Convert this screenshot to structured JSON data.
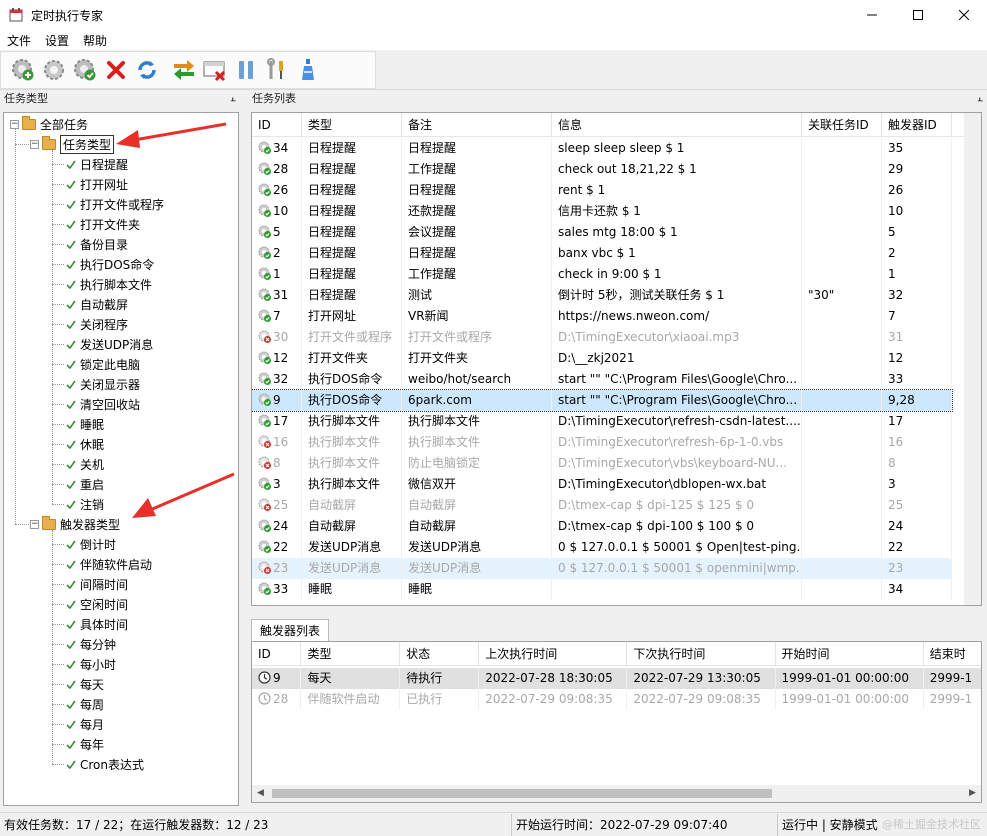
{
  "window": {
    "title": "定时执行专家"
  },
  "menu": [
    "文件",
    "设置",
    "帮助"
  ],
  "toolbar": {
    "buttons": [
      {
        "name": "add-task-button",
        "icon": "gear-add-icon"
      },
      {
        "name": "edit-task-button",
        "icon": "gear-icon"
      },
      {
        "name": "enable-task-button",
        "icon": "gear-check-icon"
      },
      {
        "name": "delete-task-button",
        "icon": "red-x-icon"
      },
      {
        "name": "refresh-button",
        "icon": "refresh-icon"
      },
      {
        "name": "swap-button",
        "icon": "swap-arrows-icon"
      },
      {
        "name": "remove-window-button",
        "icon": "window-x-icon"
      },
      {
        "name": "pause-button",
        "icon": "pause-icon"
      },
      {
        "name": "tools-button",
        "icon": "tools-icon"
      },
      {
        "name": "bottle-button",
        "icon": "bottle-icon"
      }
    ]
  },
  "left_pane": {
    "title": "任务类型",
    "root": "全部任务",
    "task_types_label": "任务类型",
    "task_types": [
      "日程提醒",
      "打开网址",
      "打开文件或程序",
      "打开文件夹",
      "备份目录",
      "执行DOS命令",
      "执行脚本文件",
      "自动截屏",
      "关闭程序",
      "发送UDP消息",
      "锁定此电脑",
      "关闭显示器",
      "清空回收站",
      "睡眠",
      "休眠",
      "关机",
      "重启",
      "注销"
    ],
    "trigger_types_label": "触发器类型",
    "trigger_types": [
      "倒计时",
      "伴随软件启动",
      "间隔时间",
      "空闲时间",
      "具体时间",
      "每分钟",
      "每小时",
      "每天",
      "每周",
      "每月",
      "每年",
      "Cron表达式"
    ]
  },
  "task_list": {
    "title": "任务列表",
    "columns": [
      "ID",
      "类型",
      "备注",
      "信息",
      "关联任务ID",
      "触发器ID"
    ],
    "rows": [
      {
        "id": "34",
        "type": "日程提醒",
        "note": "日程提醒",
        "info": "sleep sleep sleep $ 1",
        "rel": "",
        "trig": "35",
        "state": "on"
      },
      {
        "id": "28",
        "type": "日程提醒",
        "note": "工作提醒",
        "info": "check out 18,21,22 $ 1",
        "rel": "",
        "trig": "29",
        "state": "on"
      },
      {
        "id": "26",
        "type": "日程提醒",
        "note": "日程提醒",
        "info": "rent $ 1",
        "rel": "",
        "trig": "26",
        "state": "on"
      },
      {
        "id": "10",
        "type": "日程提醒",
        "note": "还款提醒",
        "info": "信用卡还款 $ 1",
        "rel": "",
        "trig": "10",
        "state": "on"
      },
      {
        "id": "5",
        "type": "日程提醒",
        "note": "会议提醒",
        "info": "sales mtg 18:00 $ 1",
        "rel": "",
        "trig": "5",
        "state": "on"
      },
      {
        "id": "2",
        "type": "日程提醒",
        "note": "日程提醒",
        "info": "banx vbc $ 1",
        "rel": "",
        "trig": "2",
        "state": "on"
      },
      {
        "id": "1",
        "type": "日程提醒",
        "note": "工作提醒",
        "info": "check in 9:00 $ 1",
        "rel": "",
        "trig": "1",
        "state": "on"
      },
      {
        "id": "31",
        "type": "日程提醒",
        "note": "测试",
        "info": "倒计时 5秒，测试关联任务 $ 1",
        "rel": "\"30\"",
        "trig": "32",
        "state": "on"
      },
      {
        "id": "7",
        "type": "打开网址",
        "note": "VR新闻",
        "info": "https://news.nweon.com/",
        "rel": "",
        "trig": "7",
        "state": "on"
      },
      {
        "id": "30",
        "type": "打开文件或程序",
        "note": "打开文件或程序",
        "info": "D:\\TimingExecutor\\xiaoai.mp3",
        "rel": "",
        "trig": "31",
        "state": "off"
      },
      {
        "id": "12",
        "type": "打开文件夹",
        "note": "打开文件夹",
        "info": "D:\\__zkj2021",
        "rel": "",
        "trig": "12",
        "state": "on"
      },
      {
        "id": "32",
        "type": "执行DOS命令",
        "note": "weibo/hot/search",
        "info": "start \"\" \"C:\\Program Files\\Google\\Chro...",
        "rel": "",
        "trig": "33",
        "state": "on"
      },
      {
        "id": "9",
        "type": "执行DOS命令",
        "note": "6park.com",
        "info": "start \"\" \"C:\\Program Files\\Google\\Chro...",
        "rel": "",
        "trig": "9,28",
        "state": "selected"
      },
      {
        "id": "17",
        "type": "执行脚本文件",
        "note": "执行脚本文件",
        "info": "D:\\TimingExecutor\\refresh-csdn-latest....",
        "rel": "",
        "trig": "17",
        "state": "on"
      },
      {
        "id": "16",
        "type": "执行脚本文件",
        "note": "执行脚本文件",
        "info": "D:\\TimingExecutor\\refresh-6p-1-0.vbs",
        "rel": "",
        "trig": "16",
        "state": "off"
      },
      {
        "id": "8",
        "type": "执行脚本文件",
        "note": "防止电脑锁定",
        "info": "D:\\TimingExecutor\\vbs\\keyboard-NU...",
        "rel": "",
        "trig": "8",
        "state": "off"
      },
      {
        "id": "3",
        "type": "执行脚本文件",
        "note": "微信双开",
        "info": "D:\\TimingExecutor\\dblopen-wx.bat",
        "rel": "",
        "trig": "3",
        "state": "on"
      },
      {
        "id": "25",
        "type": "自动截屏",
        "note": "自动截屏",
        "info": "D:\\tmex-cap $ dpi-125 $ 125 $ 0",
        "rel": "",
        "trig": "25",
        "state": "off"
      },
      {
        "id": "24",
        "type": "自动截屏",
        "note": "自动截屏",
        "info": "D:\\tmex-cap $ dpi-100 $ 100 $ 0",
        "rel": "",
        "trig": "24",
        "state": "on"
      },
      {
        "id": "22",
        "type": "发送UDP消息",
        "note": "发送UDP消息",
        "info": "0 $ 127.0.0.1 $ 50001 $ Open|test-ping...",
        "rel": "",
        "trig": "22",
        "state": "on"
      },
      {
        "id": "23",
        "type": "发送UDP消息",
        "note": "发送UDP消息",
        "info": "0 $ 127.0.0.1 $ 50001 $ openmini|wmp...",
        "rel": "",
        "trig": "23",
        "state": "off-hover"
      },
      {
        "id": "33",
        "type": "睡眠",
        "note": "睡眠",
        "info": "",
        "rel": "",
        "trig": "34",
        "state": "on"
      }
    ]
  },
  "trigger_list": {
    "tab": "触发器列表",
    "columns": [
      "ID",
      "类型",
      "状态",
      "上次执行时间",
      "下次执行时间",
      "开始时间",
      "结束时"
    ],
    "rows": [
      {
        "id": "9",
        "type": "每天",
        "status": "待执行",
        "last": "2022-07-28 18:30:05",
        "next": "2022-07-29 13:30:05",
        "start": "1999-01-01 00:00:00",
        "end": "2999-1",
        "state": "selected"
      },
      {
        "id": "28",
        "type": "伴随软件启动",
        "status": "已执行",
        "last": "2022-07-29 09:08:35",
        "next": "2022-07-29 09:08:35",
        "start": "1999-01-01 00:00:00",
        "end": "2999-1",
        "state": "off"
      }
    ]
  },
  "status": {
    "tasks": "有效任务数：17 / 22；在运行触发器数：12 / 23",
    "start_time": "开始运行时间：2022-07-29 09:07:40",
    "mode": "运行中 | 安静模式 | 英",
    "watermark": "@稀土掘金技术社区"
  },
  "colors": {
    "selection": "#cce8ff",
    "annotation_arrow": "#e8302a",
    "folder": "#e8b04a"
  }
}
